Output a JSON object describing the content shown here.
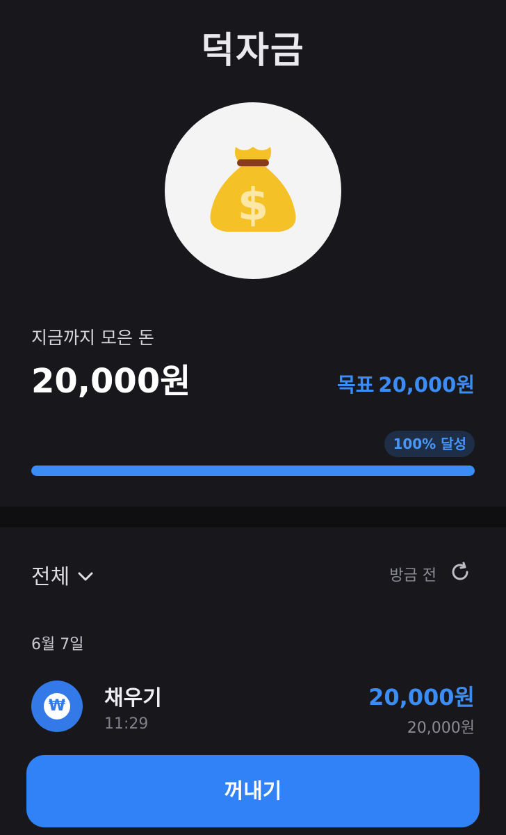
{
  "header": {
    "title": "덕자금"
  },
  "hero": {
    "icon": "money-bag-icon"
  },
  "savings": {
    "label": "지금까지 모은 돈",
    "amount": "20,000원",
    "goal_prefix": "목표",
    "goal_amount": "20,000원",
    "achievement_badge": "100% 달성",
    "progress_fraction": 1.0
  },
  "history": {
    "filter_label": "전체",
    "refresh_time": "방금 전",
    "groups": [
      {
        "date": "6월 7일",
        "items": [
          {
            "title": "채우기",
            "time": "11:29",
            "amount": "20,000원",
            "balance": "20,000원",
            "icon": "won-coin-icon"
          }
        ]
      }
    ]
  },
  "actions": {
    "withdraw_label": "꺼내기"
  },
  "colors": {
    "accent": "#3182f6",
    "background": "#17171c",
    "badge_bg": "#1e2e47"
  }
}
